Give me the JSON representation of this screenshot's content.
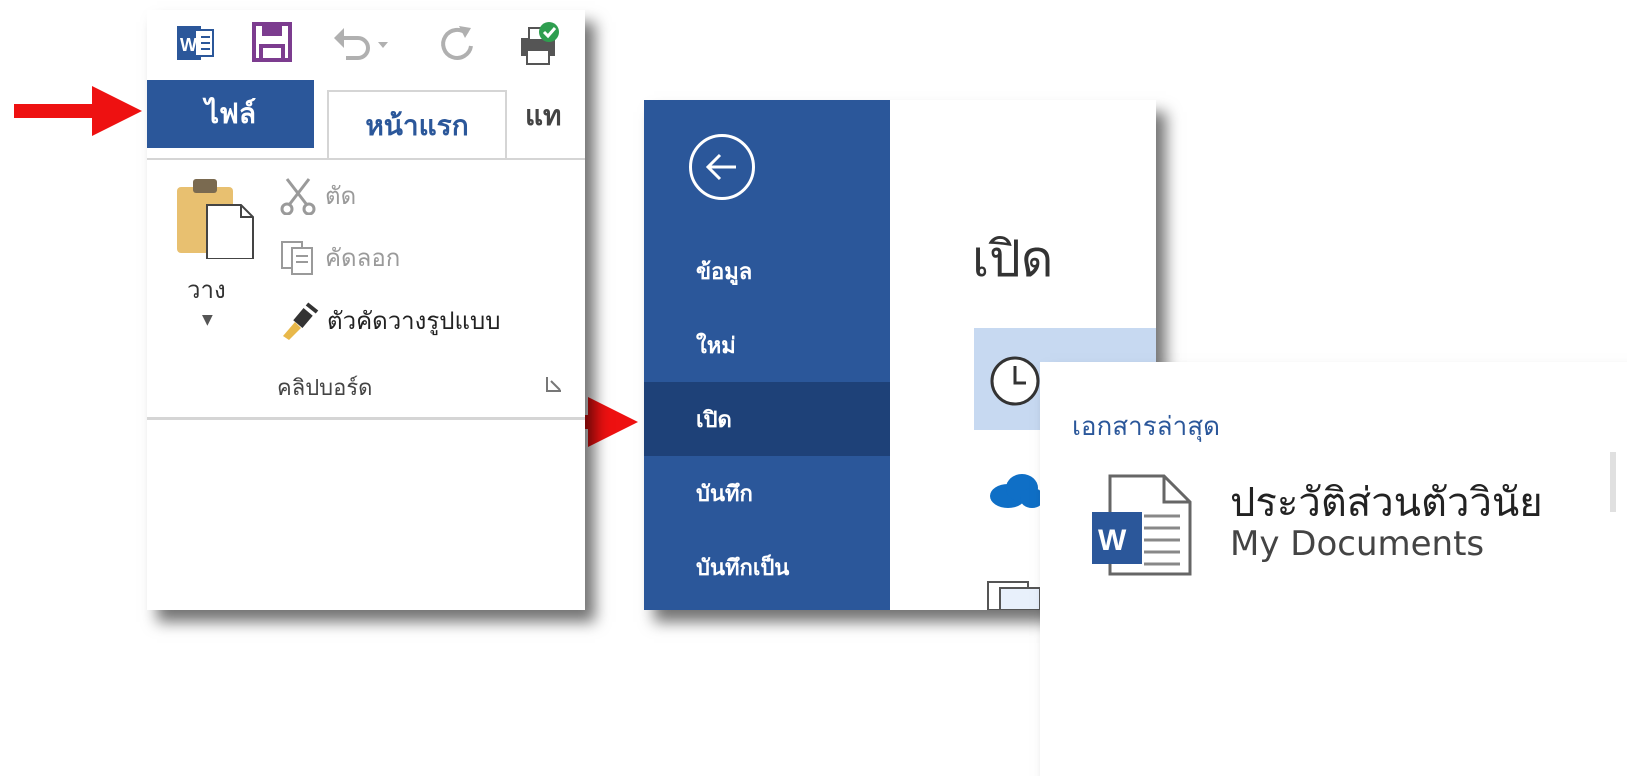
{
  "ribbon": {
    "tabs": {
      "file": "ไฟล์",
      "home": "หน้าแรก",
      "insert": "แท"
    },
    "clipboard": {
      "paste": "วาง",
      "cut": "ตัด",
      "copy": "คัดลอก",
      "format_painter": "ตัวคัดวางรูปแบบ",
      "group_label": "คลิปบอร์ด"
    },
    "colors": {
      "file_tab": "#2b579a",
      "accent": "#2b579a"
    }
  },
  "backstage": {
    "heading": "เปิด",
    "nav": [
      "ข้อมูล",
      "ใหม่",
      "เปิด",
      "บันทึก",
      "บันทึกเป็น"
    ],
    "active_nav": "เปิด",
    "colors": {
      "sidebar": "#2b579a",
      "active": "#1e4178",
      "recent_tile": "#c7d9f1"
    }
  },
  "recent": {
    "section": "เอกสารล่าสุด",
    "doc_name": "ประวัติส่วนตัววินัย",
    "doc_path": "My Documents"
  },
  "annotations": {
    "arrow_color": "#ee1111"
  }
}
